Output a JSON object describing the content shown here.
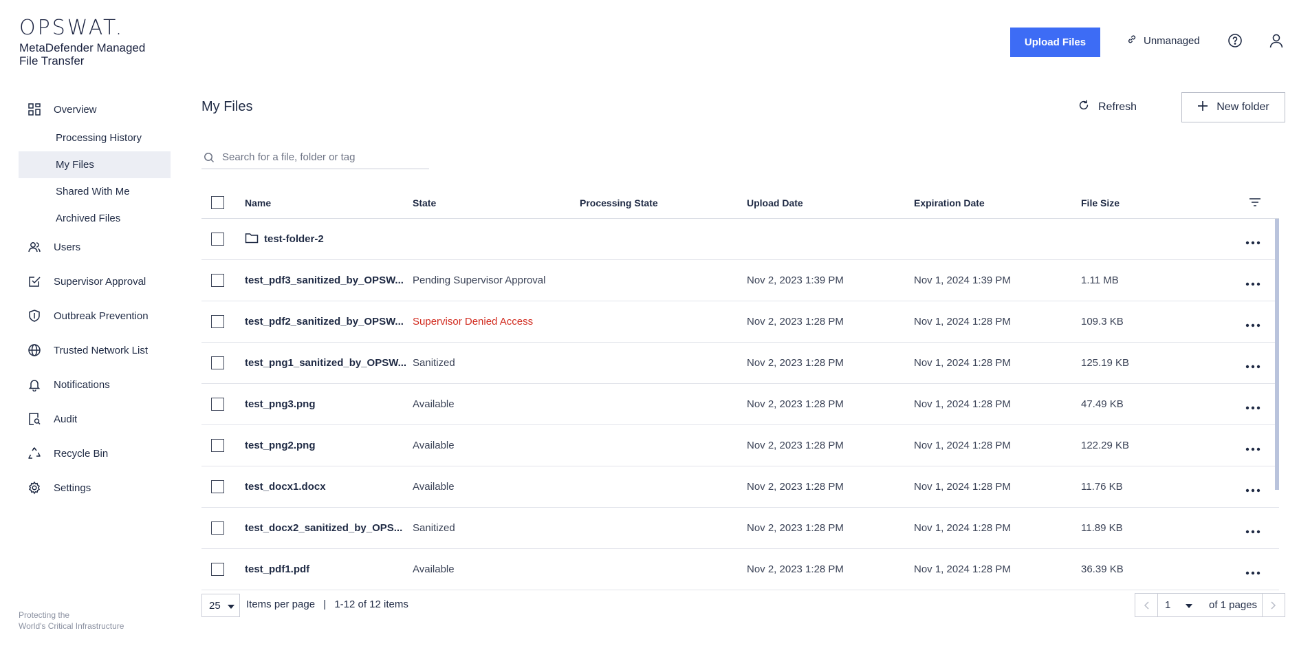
{
  "brand": {
    "logo": "OPSWAT.",
    "product": "MetaDefender Managed File Transfer"
  },
  "header": {
    "upload_label": "Upload Files",
    "unmanaged_label": "Unmanaged",
    "accent_color": "#3d6cf5"
  },
  "sidebar": {
    "overview": "Overview",
    "sub_items": [
      {
        "label": "Processing History"
      },
      {
        "label": "My Files",
        "active": true
      },
      {
        "label": "Shared With Me"
      },
      {
        "label": "Archived Files"
      }
    ],
    "items": [
      {
        "label": "Users",
        "icon": "users-icon"
      },
      {
        "label": "Supervisor Approval",
        "icon": "approval-icon"
      },
      {
        "label": "Outbreak Prevention",
        "icon": "shield-icon"
      },
      {
        "label": "Trusted Network List",
        "icon": "globe-icon"
      },
      {
        "label": "Notifications",
        "icon": "bell-icon"
      },
      {
        "label": "Audit",
        "icon": "audit-icon"
      },
      {
        "label": "Recycle Bin",
        "icon": "recycle-icon"
      },
      {
        "label": "Settings",
        "icon": "gear-icon"
      }
    ],
    "footer_line1": "Protecting the",
    "footer_line2": "World's Critical Infrastructure"
  },
  "main": {
    "title": "My Files",
    "refresh_label": "Refresh",
    "new_folder_label": "New folder",
    "search_placeholder": "Search for a file, folder or tag",
    "columns": {
      "name": "Name",
      "state": "State",
      "processing_state": "Processing State",
      "upload_date": "Upload Date",
      "expiration_date": "Expiration Date",
      "file_size": "File Size"
    },
    "rows": [
      {
        "name": "test-folder-2",
        "folder": true,
        "state": "",
        "processing": "",
        "upload": "",
        "expiration": "",
        "size": ""
      },
      {
        "name": "test_pdf3_sanitized_by_OPSW...",
        "state": "Pending Supervisor Approval",
        "processing": "",
        "upload": "Nov 2, 2023 1:39 PM",
        "expiration": "Nov 1, 2024 1:39 PM",
        "size": "1.11 MB"
      },
      {
        "name": "test_pdf2_sanitized_by_OPSW...",
        "state": "Supervisor Denied Access",
        "denied": true,
        "processing": "",
        "upload": "Nov 2, 2023 1:28 PM",
        "expiration": "Nov 1, 2024 1:28 PM",
        "size": "109.3 KB"
      },
      {
        "name": "test_png1_sanitized_by_OPSW...",
        "state": "Sanitized",
        "processing": "",
        "upload": "Nov 2, 2023 1:28 PM",
        "expiration": "Nov 1, 2024 1:28 PM",
        "size": "125.19 KB"
      },
      {
        "name": "test_png3.png",
        "state": "Available",
        "processing": "",
        "upload": "Nov 2, 2023 1:28 PM",
        "expiration": "Nov 1, 2024 1:28 PM",
        "size": "47.49 KB"
      },
      {
        "name": "test_png2.png",
        "state": "Available",
        "processing": "",
        "upload": "Nov 2, 2023 1:28 PM",
        "expiration": "Nov 1, 2024 1:28 PM",
        "size": "122.29 KB"
      },
      {
        "name": "test_docx1.docx",
        "state": "Available",
        "processing": "",
        "upload": "Nov 2, 2023 1:28 PM",
        "expiration": "Nov 1, 2024 1:28 PM",
        "size": "11.76 KB"
      },
      {
        "name": "test_docx2_sanitized_by_OPS...",
        "state": "Sanitized",
        "processing": "",
        "upload": "Nov 2, 2023 1:28 PM",
        "expiration": "Nov 1, 2024 1:28 PM",
        "size": "11.89 KB"
      },
      {
        "name": "test_pdf1.pdf",
        "state": "Available",
        "processing": "",
        "upload": "Nov 2, 2023 1:28 PM",
        "expiration": "Nov 1, 2024 1:28 PM",
        "size": "36.39 KB"
      }
    ],
    "denied_color": "#d12b1f"
  },
  "pagination": {
    "per_page": "25",
    "per_page_label": "Items per page",
    "separator": "|",
    "range_label": "1-12 of 12 items",
    "current_page": "1",
    "pages_label": "of 1 pages"
  }
}
